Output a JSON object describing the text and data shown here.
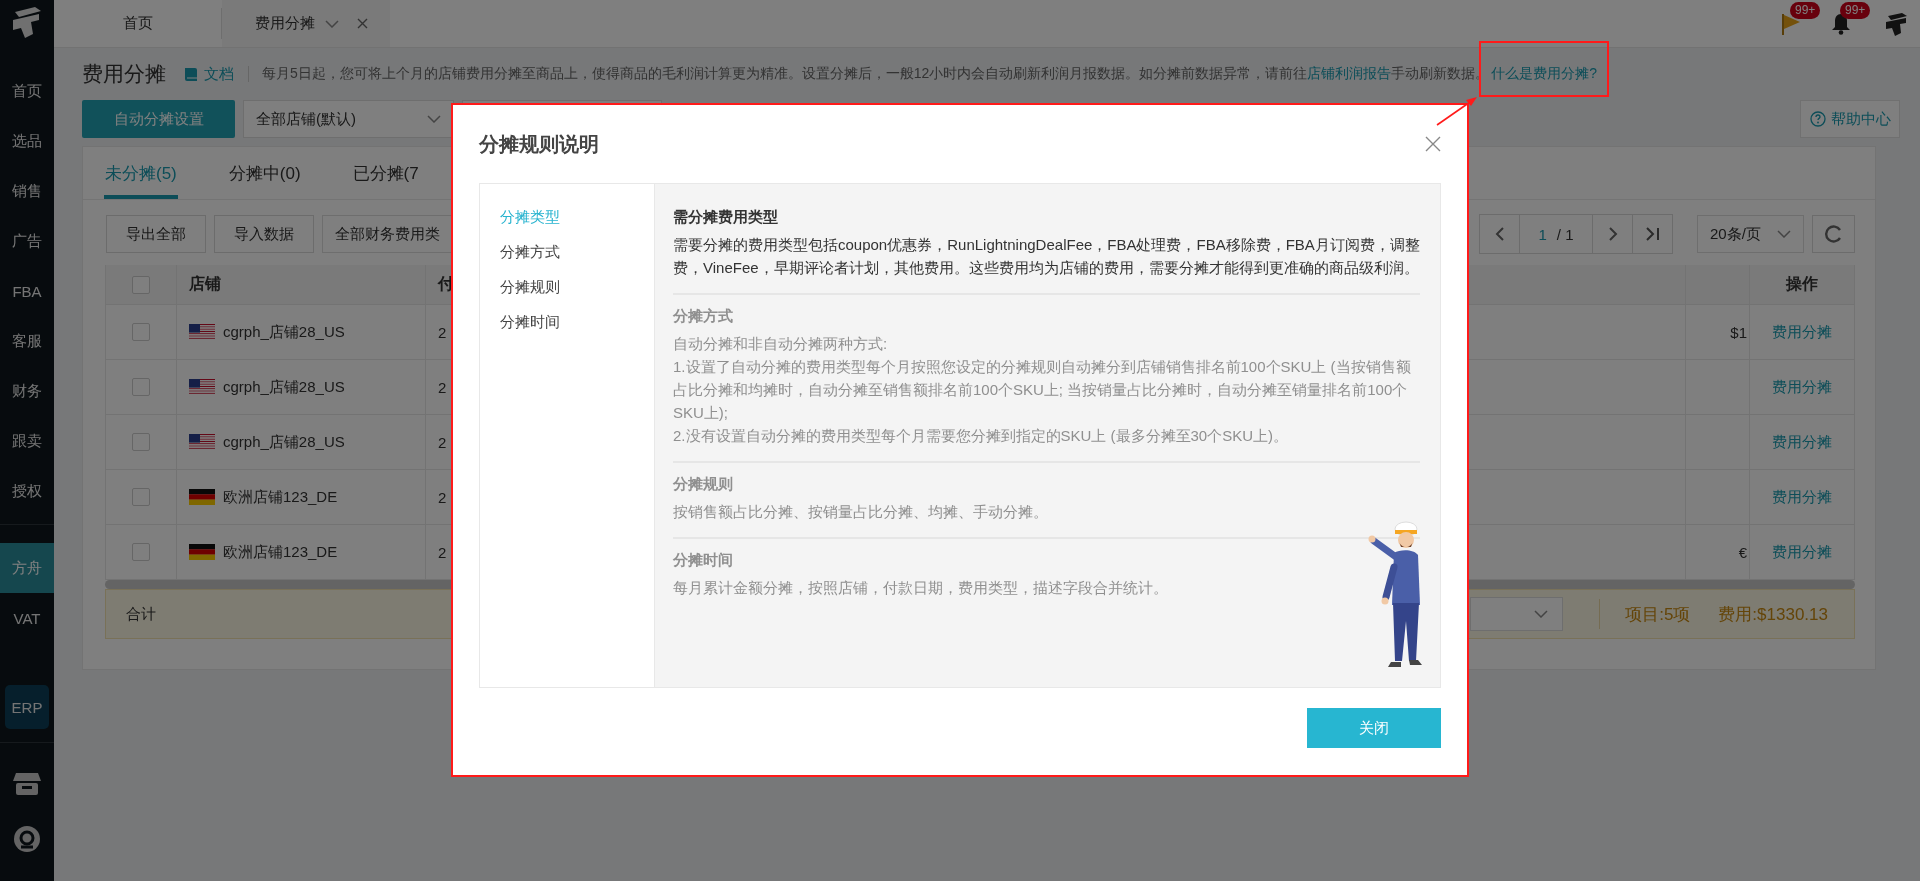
{
  "sidebar": {
    "items": [
      {
        "label": "首页",
        "selected": false
      },
      {
        "label": "选品",
        "selected": false
      },
      {
        "label": "销售",
        "selected": false
      },
      {
        "label": "广告",
        "selected": false
      },
      {
        "label": "FBA",
        "selected": false
      },
      {
        "label": "客服",
        "selected": false
      },
      {
        "label": "财务",
        "selected": false
      },
      {
        "label": "跟卖",
        "selected": false
      },
      {
        "label": "授权",
        "selected": false
      }
    ],
    "lower_items": [
      {
        "label": "方舟",
        "selected": true
      },
      {
        "label": "VAT",
        "selected": false
      }
    ],
    "erp_button": "ERP"
  },
  "tab_bar": {
    "tabs": [
      {
        "label": "首页",
        "selected": false
      },
      {
        "label": "费用分摊",
        "selected": true
      }
    ],
    "flag_badge": "99+",
    "bell_badge": "99+"
  },
  "header": {
    "title": "费用分摊",
    "doc_link": "文档",
    "description": {
      "before": "每月5日起，您可将上个月的店铺费用分摊至商品上，使得商品的毛利润计算更为精准。设置分摊后，一般12小时内会自动刷新利润月报数据。如分摊前数据异常，请前往",
      "link": "店铺利润报告",
      "after": "手动刷新数据。"
    },
    "help_link": "什么是费用分摊?"
  },
  "toolbar": {
    "primary_button": "自动分摊设置",
    "store_select": "全部店铺(默认)",
    "help_button": "帮助中心"
  },
  "card": {
    "tabs": [
      {
        "label": "未分摊(5)",
        "selected": true
      },
      {
        "label": "分摊中(0)",
        "selected": false
      },
      {
        "label": "已分摊(7",
        "selected": false
      }
    ],
    "buttons": [
      "导出全部",
      "导入数据"
    ],
    "fee_type_select": "全部财务费用类",
    "pagination": {
      "page": "1",
      "total": "/ 1",
      "page_size": "20条/页"
    },
    "table": {
      "header_checked": false,
      "columns": [
        "店铺",
        "付",
        "操作"
      ],
      "rows": [
        {
          "checked": false,
          "kind": "us",
          "store": "cgrph_店铺28_US",
          "column_3": "2",
          "amount": "$1",
          "action": "费用分摊"
        },
        {
          "checked": false,
          "kind": "us",
          "store": "cgrph_店铺28_US",
          "column_3": "2",
          "action": "费用分摊"
        },
        {
          "checked": false,
          "kind": "us",
          "store": "cgrph_店铺28_US",
          "column_3": "2",
          "action": "费用分摊"
        },
        {
          "checked": false,
          "kind": "de",
          "store": "欧洲店铺123_DE",
          "column_3": "2",
          "action": "费用分摊"
        },
        {
          "checked": false,
          "kind": "de",
          "store": "欧洲店铺123_DE",
          "column_3": "2",
          "amount": "€",
          "action": "费用分摊"
        }
      ]
    },
    "summary": {
      "label": "合计",
      "items": "项目:5项",
      "fee": "费用:$1330.13"
    }
  },
  "modal": {
    "title": "分摊规则说明",
    "nav": [
      {
        "label": "分摊类型",
        "selected": true
      },
      {
        "label": "分摊方式",
        "selected": false
      },
      {
        "label": "分摊规则",
        "selected": false
      },
      {
        "label": "分摊时间",
        "selected": false
      }
    ],
    "sections": [
      {
        "title": "需分摊费用类型",
        "active": true,
        "lines": [
          "需要分摊的费用类型包括coupon优惠券，RunLightningDealFee，FBA处理费，FBA移除费，FBA月订阅费，调整费，VineFee，早期评论者计划，其他费用。这些费用均为店铺的费用，需要分摊才能得到更准确的商品级利润。"
        ]
      },
      {
        "title": "分摊方式",
        "active": false,
        "lines": [
          "自动分摊和非自动分摊两种方式:",
          "1.设置了自动分摊的费用类型每个月按照您设定的分摊规则自动摊分到店铺销售排名前100个SKU上 (当按销售额占比分摊和均摊时，自动分摊至销售额排名前100个SKU上; 当按销量占比分摊时，自动分摊至销量排名前100个SKU上);",
          "2.没有设置自动分摊的费用类型每个月需要您分摊到指定的SKU上 (最多分摊至30个SKU上)。"
        ]
      },
      {
        "title": "分摊规则",
        "active": false,
        "lines": [
          "按销售额占比分摊、按销量占比分摊、均摊、手动分摊。"
        ]
      },
      {
        "title": "分摊时间",
        "active": false,
        "lines": [
          "每月累计金额分摊，按照店铺，付款日期，费用类型，描述字段合并统计。"
        ]
      }
    ],
    "close_button": "关闭"
  }
}
